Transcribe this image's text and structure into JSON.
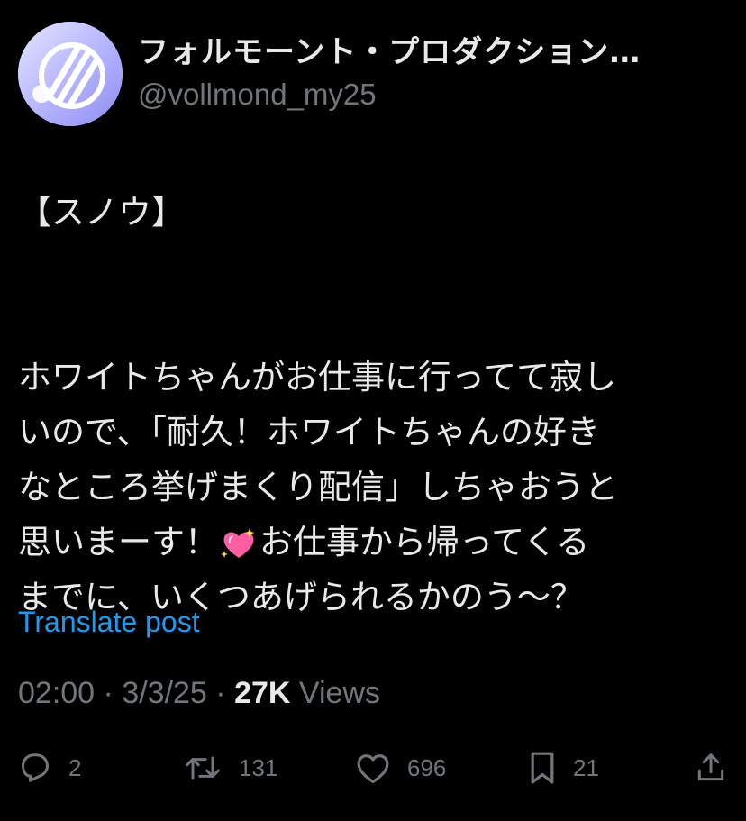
{
  "header": {
    "display_name": "フォルモーント・プロダクション…",
    "handle": "@vollmond_my25"
  },
  "post": {
    "line1": "【スノウ】",
    "line2": "ホワイトちゃんがお仕事に行ってて寂し",
    "line3": "いので、「耐久！ホワイトちゃんの好き",
    "line4": "なところ挙げまくり配信」しちゃおうと",
    "line5a": "思いまーす！",
    "emoji": "sparkling-heart-emoji",
    "line5b": "お仕事から帰ってくる",
    "line6": "までに、いくつあげられるかのう～？"
  },
  "translate_label": "Translate post",
  "meta": {
    "time": "02:00",
    "sep1": " · ",
    "date": "3/3/25",
    "sep2": " · ",
    "views_count": "27K",
    "views_label": " Views"
  },
  "actions": {
    "reply_count": "2",
    "repost_count": "131",
    "like_count": "696",
    "bookmark_count": "21"
  },
  "colors": {
    "background": "#000000",
    "text": "#e7e9ea",
    "muted": "#71767b",
    "link": "#1d9bf0",
    "avatar": "#b7b6ff"
  }
}
